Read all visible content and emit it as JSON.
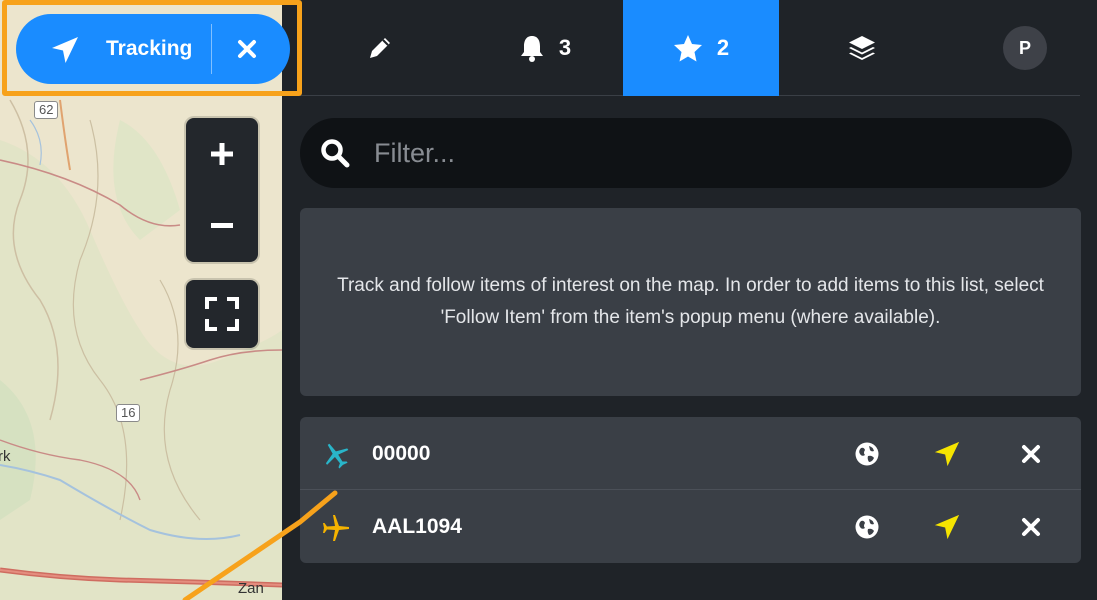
{
  "colors": {
    "accent": "#1a8cff",
    "panel_bg": "#1f2328",
    "card_bg": "#3a3f46",
    "follow_arrow": "#f5e400",
    "aircraft_teal": "#29b5c9",
    "aircraft_yellow": "#f5b300",
    "highlight": "#f7a21b"
  },
  "map": {
    "route_shields": [
      "62",
      "16"
    ],
    "place_labels": [
      "rk",
      "Zan"
    ],
    "controls": {
      "zoom_in": "+",
      "zoom_out": "−",
      "fullscreen_icon": "expand-icon"
    }
  },
  "tracking_pill": {
    "icon": "location-arrow-icon",
    "label": "Tracking",
    "close_icon": "close-icon"
  },
  "tabs": [
    {
      "icon": "pencil-icon",
      "count": ""
    },
    {
      "icon": "bell-icon",
      "count": "3"
    },
    {
      "icon": "star-icon",
      "count": "2",
      "active": true
    },
    {
      "icon": "layers-icon",
      "count": ""
    },
    {
      "icon": "avatar",
      "label": "P"
    }
  ],
  "filter": {
    "placeholder": "Filter...",
    "value": "",
    "icon": "search-icon"
  },
  "info": {
    "text": "Track and follow items of interest on the map. In order to add items to this list, select 'Follow Item' from the item's popup menu (where available)."
  },
  "tracked_items": [
    {
      "name": "00000",
      "icon": "airplane-icon",
      "icon_color": "#29b5c9"
    },
    {
      "name": "AAL1094",
      "icon": "airplane-icon",
      "icon_color": "#f5b300"
    }
  ],
  "row_actions": {
    "globe_icon": "globe-icon",
    "follow_icon": "location-arrow-icon",
    "remove_icon": "close-icon"
  }
}
